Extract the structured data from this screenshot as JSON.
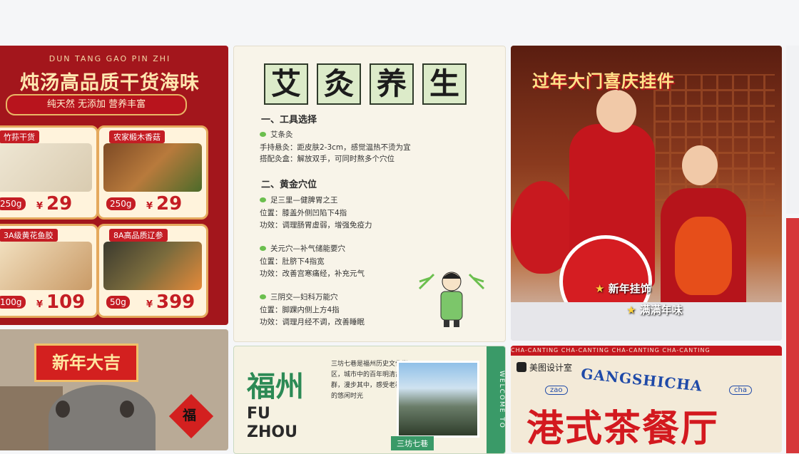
{
  "card1": {
    "subtitle": "DUN TANG GAO PIN ZHI",
    "title": "炖汤高品质干货海味",
    "tagline": "纯天然 无添加 营养丰富",
    "products": [
      {
        "tag": "竹荪干货",
        "weight": "250g",
        "currency": "¥",
        "price": "29"
      },
      {
        "tag": "农家椴木香菇",
        "weight": "250g",
        "currency": "¥",
        "price": "29"
      },
      {
        "tag": "3A级黄花鱼胶",
        "weight": "100g",
        "currency": "¥",
        "price": "109"
      },
      {
        "tag": "8A高品质辽参",
        "weight": "50g",
        "currency": "¥",
        "price": "399"
      }
    ]
  },
  "card2": {
    "title_chars": [
      "艾",
      "灸",
      "养",
      "生"
    ],
    "section1": "一、工具选择",
    "tool": "艾条灸",
    "line1": "手持悬灸：距皮肤2-3cm，感觉温热不烫为宜",
    "line2": "搭配灸盒：解放双手，可同时熬多个穴位",
    "section2": "二、黄金穴位",
    "p1_title": "足三里—健脾胃之王",
    "p1_pos": "位置：膝盖外侧凹陷下4指",
    "p1_eff": "功效：调理肠胃虚弱，增强免疫力",
    "p2_title": "关元穴—补气储能要穴",
    "p2_pos": "位置：肚脐下4指宽",
    "p2_eff": "功效：改善宫寒痛经，补充元气",
    "p3_title": "三阴交—妇科万能穴",
    "p3_pos": "位置：脚踝内侧上方4指",
    "p3_eff": "功效：调理月经不调，改善睡眠"
  },
  "card3": {
    "title": "过年大门喜庆挂件",
    "badge1": "新年挂饰",
    "badge2": "满满年味"
  },
  "card4": {
    "banner": "新年大吉",
    "fu": "福"
  },
  "card5": {
    "zh": "福州",
    "en1": "FU",
    "en2": "ZHOU",
    "note": "三坊七巷",
    "welcome": "WELCOME TO",
    "handwriting": "三坊七巷是福州历史文化街区，城市中的百年明清古建群，漫步其中，感受老福州的悠闲时光"
  },
  "card6": {
    "strip": "CHA-CANTING   CHA-CANTING   CHA-CANTING   CHA-CANTING",
    "brand": "美图设计室",
    "gang": "GANGSHICHA",
    "zao": "zao",
    "cha": "cha",
    "big": "港式茶餐厅"
  },
  "colors": {
    "red": "#a3161c",
    "green": "#2c8a55",
    "blue": "#1f4aa8"
  }
}
